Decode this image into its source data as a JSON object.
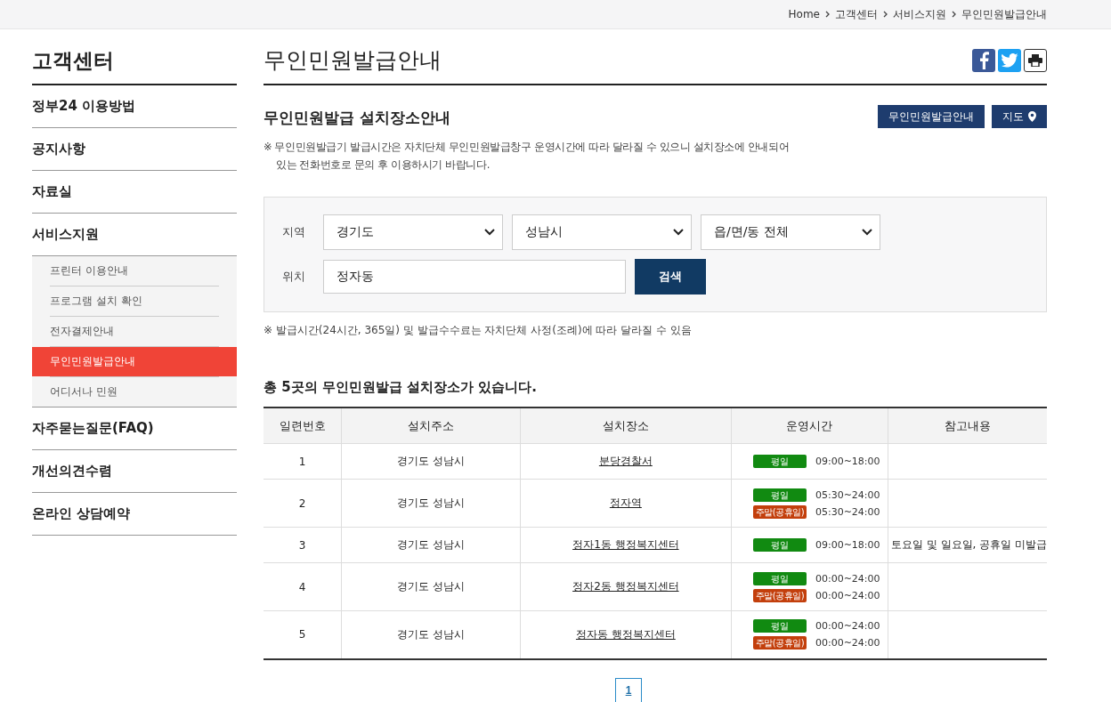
{
  "breadcrumb": [
    "Home",
    "고객센터",
    "서비스지원",
    "무인민원발급안내"
  ],
  "sidebar": {
    "title": "고객센터",
    "items": [
      {
        "label": "정부24 이용방법",
        "selected": false
      },
      {
        "label": "공지사항",
        "selected": false
      },
      {
        "label": "자료실",
        "selected": false
      },
      {
        "label": "서비스지원",
        "selected": false,
        "children": [
          {
            "label": "프린터 이용안내",
            "selected": false
          },
          {
            "label": "프로그램 설치 확인",
            "selected": false
          },
          {
            "label": "전자결제안내",
            "selected": false
          },
          {
            "label": "무인민원발급안내",
            "selected": true
          },
          {
            "label": "어디서나 민원",
            "selected": false
          }
        ]
      },
      {
        "label": "자주묻는질문(FAQ)",
        "selected": false
      },
      {
        "label": "개선의견수렴",
        "selected": false
      },
      {
        "label": "온라인 상담예약",
        "selected": false
      }
    ]
  },
  "page_title": "무인민원발급안내",
  "section_title": "무인민원발급 설치장소안내",
  "section_buttons": [
    {
      "label": "무인민원발급안내",
      "kind": "plain"
    },
    {
      "label": "지도",
      "kind": "map"
    }
  ],
  "notice": "※ 무인민원발급기 발급시간은 자치단체 무인민원발급창구 운영시간에 따라 달라질 수 있으니 설치장소에 안내되어 있는 전화번호로 문의 후 이용하시기 바랍니다.",
  "search": {
    "region_label": "지역",
    "selects": [
      "경기도",
      "성남시",
      "읍/면/동 전체"
    ],
    "location_label": "위치",
    "location_value": "정자동",
    "button": "검색"
  },
  "search_note": "※ 발급시간(24시간, 365일) 및 발급수수료는 자치단체 사정(조례)에 따라 달라질 수 있음",
  "result_title": "총 **5**곳의 무인민원발급 설치장소가 있습니다.",
  "table": {
    "columns": [
      "일련번호",
      "설치주소",
      "설치장소",
      "운영시간",
      "참고내용"
    ],
    "rows": [
      {
        "no": "1",
        "address": "경기도 성남시",
        "place": "분당경찰서",
        "hours": [
          {
            "kind": "weekday",
            "label": "평일",
            "time": "09:00~18:00"
          }
        ]
      },
      {
        "no": "2",
        "address": "경기도 성남시",
        "place": "정자역",
        "hours": [
          {
            "kind": "weekday",
            "label": "평일",
            "time": "05:30~24:00"
          },
          {
            "kind": "weekend",
            "label": "주말(공휴일)",
            "time": "05:30~24:00"
          }
        ]
      },
      {
        "no": "3",
        "address": "경기도 성남시",
        "place": "정자1동 행정복지센터",
        "hours": [
          {
            "kind": "weekday",
            "label": "평일",
            "time": "09:00~18:00"
          }
        ],
        "note": "토요일 및 일요일, 공휴일 미발급"
      },
      {
        "no": "4",
        "address": "경기도 성남시",
        "place": "정자2동 행정복지센터",
        "hours": [
          {
            "kind": "weekday",
            "label": "평일",
            "time": "00:00~24:00"
          },
          {
            "kind": "weekend",
            "label": "주말(공휴일)",
            "time": "00:00~24:00"
          }
        ]
      },
      {
        "no": "5",
        "address": "경기도 성남시",
        "place": "정자동 행정복지센터",
        "hours": [
          {
            "kind": "weekday",
            "label": "평일",
            "time": "00:00~24:00"
          },
          {
            "kind": "weekend",
            "label": "주말(공휴일)",
            "time": "00:00~24:00"
          }
        ]
      }
    ]
  },
  "pagination": [
    {
      "label": "1",
      "selected": true
    }
  ]
}
